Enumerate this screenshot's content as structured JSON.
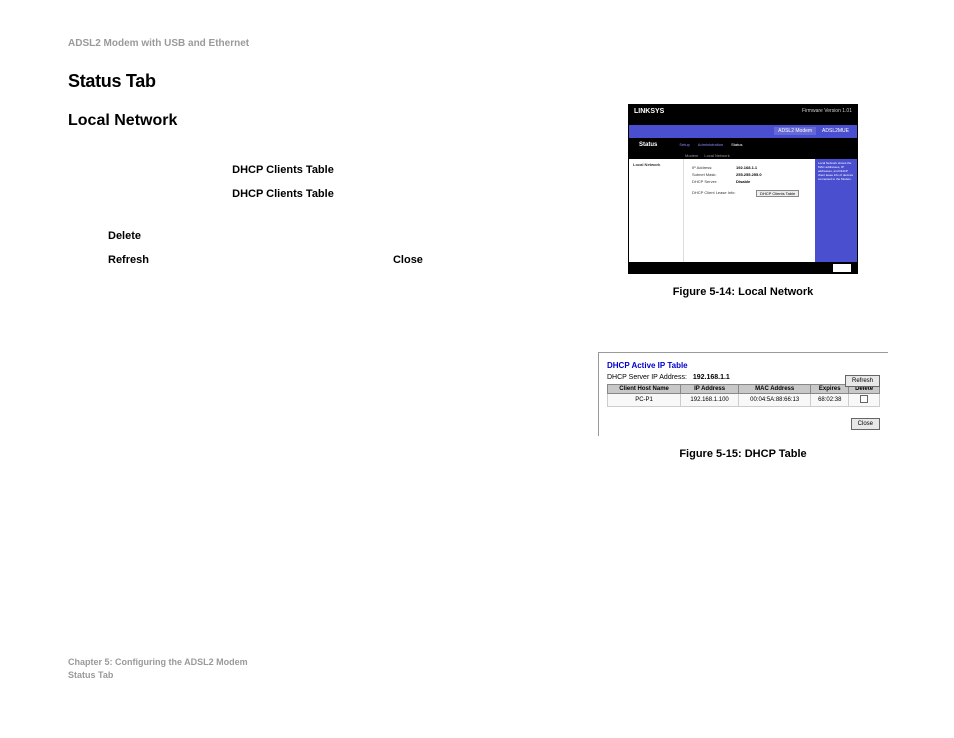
{
  "header": {
    "product": "ADSL2 Modem with USB and Ethernet"
  },
  "headings": {
    "status_tab": "Status Tab",
    "local_network": "Local Network"
  },
  "labels": {
    "dhcp_clients_table_1": "DHCP Clients Table",
    "dhcp_clients_table_2": "DHCP Clients Table",
    "delete": "Delete",
    "refresh": "Refresh",
    "close": "Close"
  },
  "figure1": {
    "caption": "Figure 5-14: Local Network",
    "brand": "LINKSYS",
    "firmware": "Firmware Version 1.01",
    "tabs": [
      "ADSL2 Modem",
      "ADSL2MUE"
    ],
    "navrow": {
      "title": "Status",
      "items": [
        "Setup",
        "Administration",
        "Status"
      ]
    },
    "subtabs": [
      "Modem",
      "Local Network"
    ],
    "sidebar_label": "Local Network",
    "fields": {
      "ip_label": "IP Address:",
      "ip_val": "192.168.1.1",
      "mask_label": "Subnet Mask:",
      "mask_val": "255.255.255.0",
      "dhcp_label": "DHCP Server:",
      "dhcp_val": "Disable",
      "lease_label": "DHCP Client Lease Info:",
      "lease_btn": "DHCP Clients Table"
    },
    "help": "Local Network shows the MAC addresses, IP addresses, and DHCP client lease info of devices connected to the Modem."
  },
  "figure2": {
    "caption": "Figure 5-15: DHCP Table",
    "title": "DHCP Active IP Table",
    "server_label": "DHCP Server IP Address:",
    "server_value": "192.168.1.1",
    "refresh_btn": "Refresh",
    "delete_btn": "Delete",
    "close_btn": "Close",
    "columns": [
      "Client Host Name",
      "IP Address",
      "MAC Address",
      "Expires"
    ],
    "row": {
      "host": "PC-P1",
      "ip": "192.168.1.100",
      "mac": "00:04:5A:88:66:13",
      "expires": "68:02:38"
    }
  },
  "footer": {
    "chapter": "Chapter 5: Configuring the ADSL2 Modem",
    "section": "Status Tab"
  }
}
